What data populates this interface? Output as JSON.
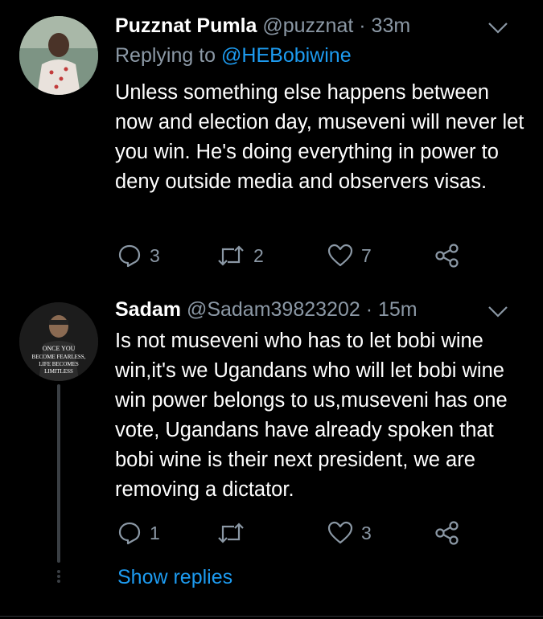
{
  "tweets": [
    {
      "name": "Puzznat Pumla",
      "handle": "@puzznat",
      "time": "33m",
      "replying_prefix": "Replying to ",
      "replying_to": "@HEBobiwine",
      "text": "Unless something else happens between now and election day, museveni will never let you win. He's doing everything in power to deny outside media and observers visas.",
      "replies": "3",
      "retweets": "2",
      "likes": "7"
    },
    {
      "name": "Sadam",
      "handle": "@Sadam39823202",
      "time": "15m",
      "text": "Is not museveni who has to let bobi wine win,it's we Ugandans who will let bobi wine win power belongs to us,museveni has one vote, Ugandans have already spoken that bobi wine is their next president, we are removing a dictator.",
      "replies": "1",
      "retweets": "",
      "likes": "3",
      "avatar_text": [
        "ONCE YOU",
        "BECOME FEARLESS,",
        "LIFE BECOMES",
        "LIMITLESS"
      ]
    }
  ],
  "separator": " · ",
  "show_replies": "Show replies",
  "colors": {
    "background": "#000000",
    "secondary_text": "#8b98a5",
    "link": "#1d9bf0",
    "thread_line": "#3a3f44"
  }
}
